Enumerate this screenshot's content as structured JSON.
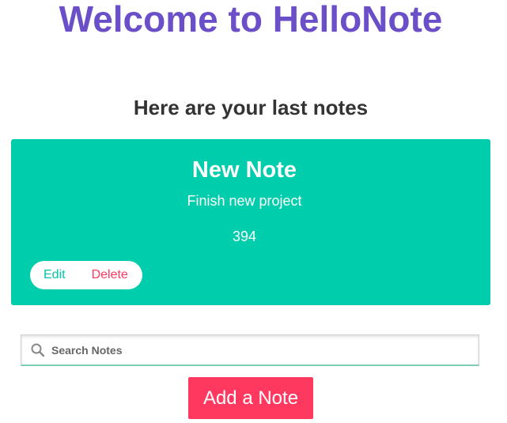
{
  "header": {
    "title": "Welcome to HelloNote",
    "subtitle": "Here are your last notes"
  },
  "notes": [
    {
      "title": "New Note",
      "body": "Finish new project",
      "count": "394",
      "edit_label": "Edit",
      "delete_label": "Delete"
    }
  ],
  "search": {
    "placeholder": "Search Notes",
    "value": "",
    "icon": "search-icon"
  },
  "actions": {
    "add_label": "Add a Note"
  },
  "colors": {
    "title": "#6b4fc9",
    "note_card": "#00cdab",
    "edit": "#00c4a6",
    "danger": "#ff3860"
  }
}
